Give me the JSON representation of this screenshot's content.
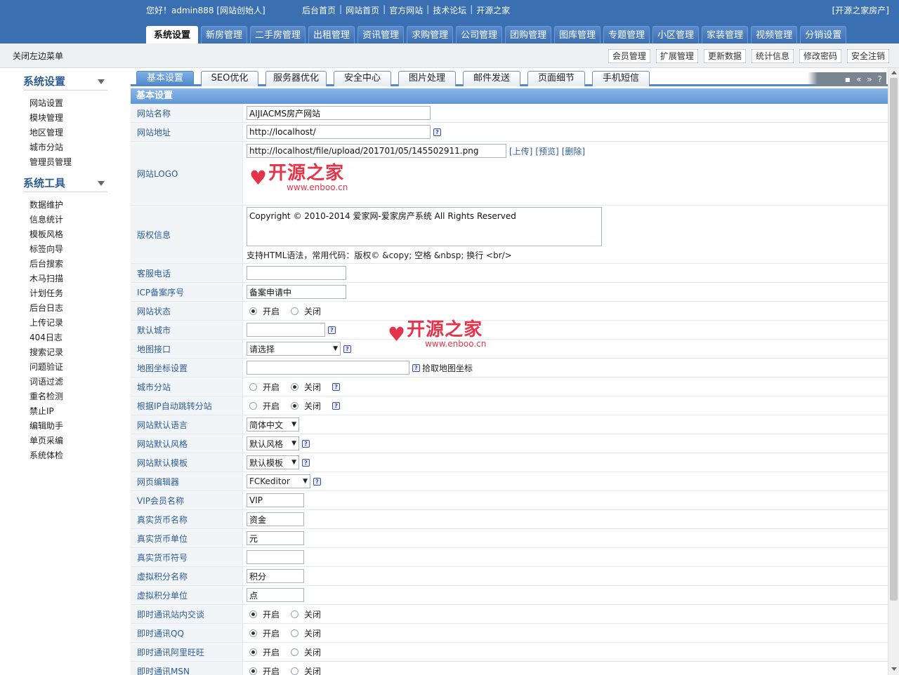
{
  "header": {
    "greeting": "您好！admin888 [网站创始人]",
    "links": [
      "后台首页",
      "网站首页",
      "官方网站",
      "技术论坛",
      "开源之家"
    ],
    "brand": "[开源之家房产]"
  },
  "main_tabs": [
    "系统设置",
    "新房管理",
    "二手房管理",
    "出租管理",
    "资讯管理",
    "求购管理",
    "公司管理",
    "团购管理",
    "图库管理",
    "专题管理",
    "小区管理",
    "家装管理",
    "视频管理",
    "分销设置"
  ],
  "subbar": {
    "close_left": "关闭左边菜单",
    "buttons": [
      "会员管理",
      "扩展管理",
      "更新数据",
      "统计信息",
      "修改密码",
      "安全注销"
    ]
  },
  "left_menu": {
    "group1_title": "系统设置",
    "group1_items": [
      "网站设置",
      "模块管理",
      "地区管理",
      "城市分站",
      "管理员管理"
    ],
    "group2_title": "系统工具",
    "group2_items": [
      "数据维护",
      "信息统计",
      "模板风格",
      "标签向导",
      "后台搜索",
      "木马扫描",
      "计划任务",
      "后台日志",
      "上传记录",
      "404日志",
      "搜索记录",
      "问题验证",
      "词语过滤",
      "重名检测",
      "禁止IP",
      "编辑助手",
      "单页采编",
      "系统体检"
    ]
  },
  "sub_tabs": [
    "基本设置",
    "SEO优化",
    "服务器优化",
    "安全中心",
    "图片处理",
    "邮件发送",
    "页面细节",
    "手机短信"
  ],
  "tab_tools": [
    "▪",
    "«",
    "»",
    "?"
  ],
  "section_title": "基本设置",
  "logo": {
    "text": "开源之家",
    "url": "www.enboo.cn"
  },
  "form": {
    "site_name_label": "网站名称",
    "site_name": "AIJIACMS房产网站",
    "site_url_label": "网站地址",
    "site_url": "http://localhost/",
    "logo_label": "网站LOGO",
    "logo_path": "http://localhost/file/upload/201701/05/145502911.png",
    "upload": "[上传]",
    "preview": "[预览]",
    "delete": "[删除]",
    "copyright_label": "版权信息",
    "copyright": "Copyright © 2010-2014 爱家网-爱家房产系统 All Rights Reserved",
    "copyright_hint": "支持HTML语法，常用代码：版权© &copy; 空格 &nbsp; 换行 <br/>",
    "phone_label": "客服电话",
    "phone": "",
    "icp_label": "ICP备案序号",
    "icp": "备案申请中",
    "status_label": "网站状态",
    "default_city_label": "默认城市",
    "default_city": "",
    "map_api_label": "地图接口",
    "map_api": "请选择",
    "map_coord_label": "地图坐标设置",
    "map_coord": "",
    "map_pick": "拾取地图坐标",
    "city_sub_label": "城市分站",
    "ip_redirect_label": "根据IP自动跳转分站",
    "language_label": "网站默认语言",
    "language": "简体中文",
    "style_label": "网站默认风格",
    "style": "默认风格",
    "template_label": "网站默认模板",
    "template": "默认模板",
    "editor_label": "网页编辑器",
    "editor": "FCKeditor",
    "vip_label": "VIP会员名称",
    "vip": "VIP",
    "money_name_label": "真实货币名称",
    "money_name": "资金",
    "money_unit_label": "真实货币单位",
    "money_unit": "元",
    "money_symbol_label": "真实货币符号",
    "money_symbol": "",
    "credit_name_label": "虚拟积分名称",
    "credit_name": "积分",
    "credit_unit_label": "虚拟积分单位",
    "credit_unit": "点",
    "im_site_label": "即时通讯站内交谈",
    "im_qq_label": "即时通讯QQ",
    "im_ww_label": "即时通讯阿里旺旺",
    "im_msn_label": "即时通讯MSN",
    "on": "开启",
    "off": "关闭"
  },
  "colors": {
    "header_blue": "#3a6fb1",
    "label_blue": "#2c5d97",
    "logo_red": "#e5344a"
  }
}
